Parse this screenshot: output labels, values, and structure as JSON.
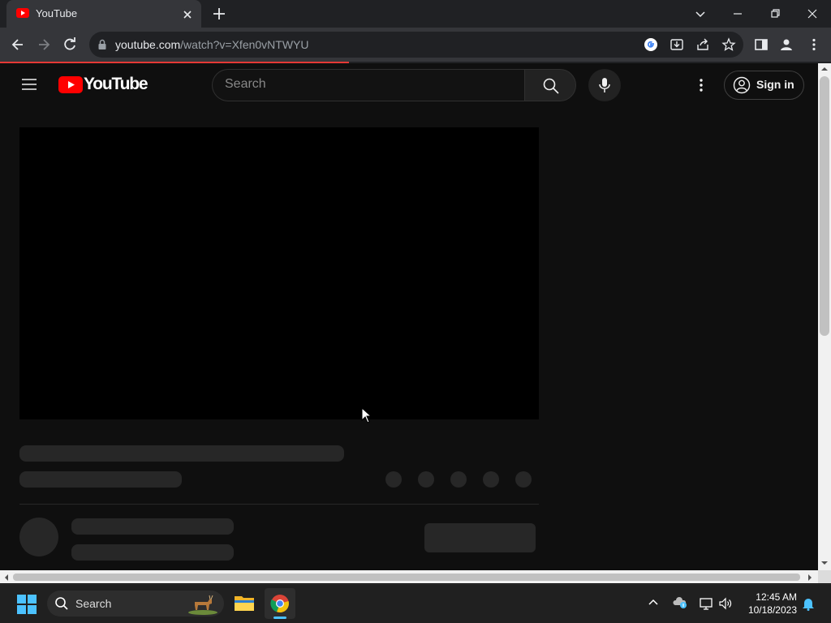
{
  "browser": {
    "tab_title": "YouTube",
    "url_host": "youtube.com",
    "url_path": "/watch?v=Xfen0vNTWYU"
  },
  "youtube": {
    "logo_text": "YouTube",
    "search_placeholder": "Search",
    "signin_label": "Sign in"
  },
  "taskbar": {
    "search_label": "Search",
    "time": "12:45 AM",
    "date": "10/18/2023"
  },
  "colors": {
    "accent_red": "#ff0000",
    "background": "#0f0f0f",
    "skeleton": "#272727"
  }
}
